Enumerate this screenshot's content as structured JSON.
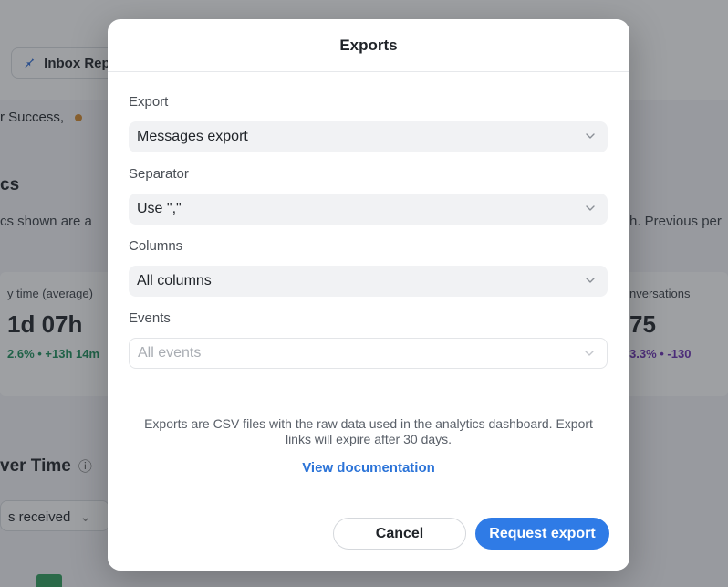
{
  "background": {
    "tab_label": "Inbox Rep",
    "crumb": "r Success,",
    "section_title": "cs",
    "section_desc_left": "cs shown are a",
    "section_desc_right": "h. Previous per",
    "card_left": {
      "label": "y time (average)",
      "value": "1d 07h",
      "delta": "2.6% • +13h 14m"
    },
    "card_right": {
      "label": "nversations",
      "value": "75",
      "delta": "3.3% • -130"
    },
    "over_time": "ver Time",
    "received": "s received"
  },
  "modal": {
    "title": "Exports",
    "fields": [
      {
        "label": "Export",
        "value": "Messages export"
      },
      {
        "label": "Separator",
        "value": "Use \",\""
      },
      {
        "label": "Columns",
        "value": "All columns"
      },
      {
        "label": "Events",
        "placeholder": "All events"
      }
    ],
    "note": "Exports are CSV files with the raw data used in the analytics dashboard. Export links will expire after 30 days.",
    "doc_link": "View documentation",
    "cancel_label": "Cancel",
    "submit_label": "Request export"
  },
  "colors": {
    "primary": "#2f7be6",
    "link": "#2c74d8",
    "overlay": "rgba(40,44,52,0.45)"
  }
}
